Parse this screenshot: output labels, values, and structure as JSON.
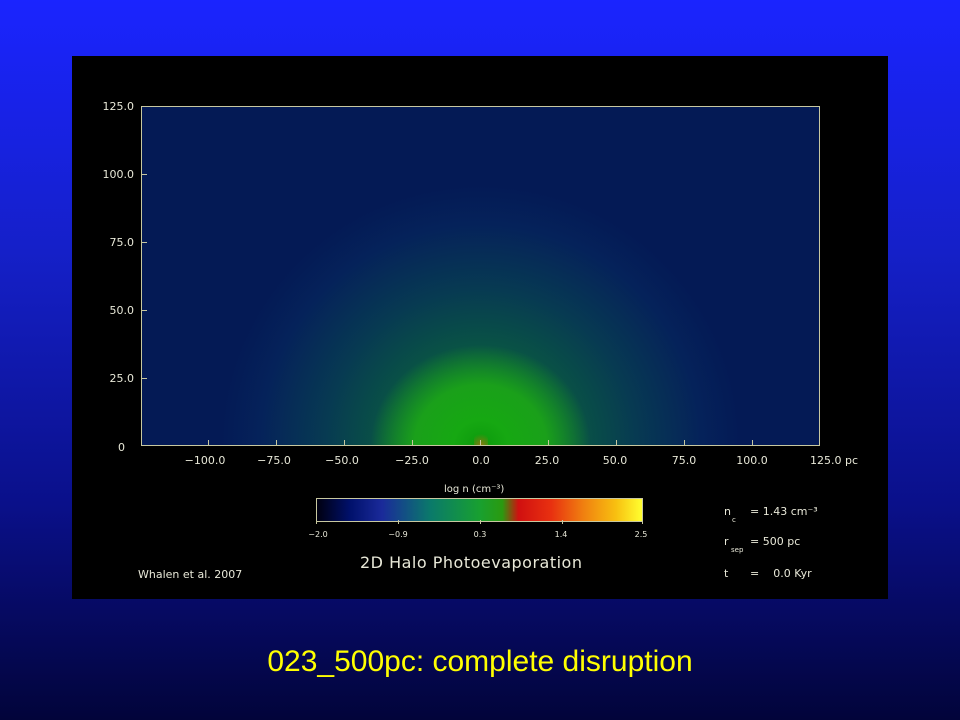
{
  "plot": {
    "y_ticks": [
      "125.0",
      "100.0",
      "75.0",
      "50.0",
      "25.0",
      "0"
    ],
    "x_ticks": [
      "−100.0",
      "−75.0",
      "−50.0",
      "−25.0",
      "0.0",
      "25.0",
      "50.0",
      "75.0",
      "100.0",
      "125.0 pc"
    ],
    "colorbar_title": "log n (cm⁻³)",
    "colorbar_ticks": [
      "−2.0",
      "−0.9",
      "0.3",
      "1.4",
      "2.5"
    ],
    "title": "2D Halo Photoevaporation",
    "credit": "Whalen et al. 2007"
  },
  "params": {
    "nc_label": "n",
    "nc_sub": "c",
    "nc_value": "= 1.43 cm⁻³",
    "rsep_label": "r",
    "rsep_sub": "sep",
    "rsep_value": "= 500 pc",
    "t_label": "t",
    "t_value": "=    0.0 Kyr"
  },
  "caption": "023_500pc: complete disruption",
  "colors": {
    "caption": "#ffff00",
    "frame": "#000000",
    "axis": "#c8c8a0"
  }
}
